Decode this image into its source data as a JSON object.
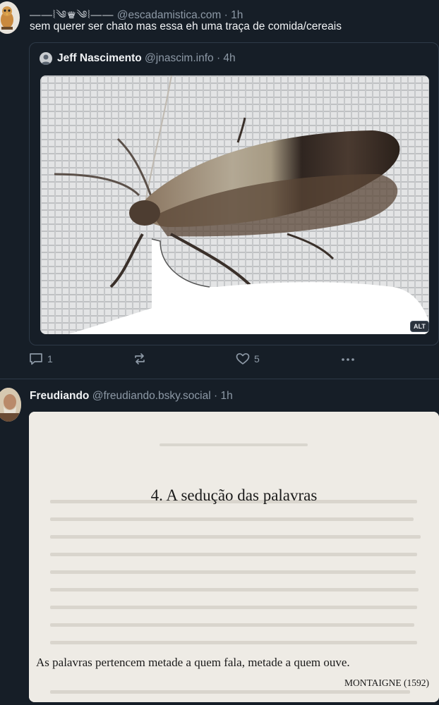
{
  "post1": {
    "handle": "@escadamistica.com",
    "ornament": "——⦚༄♛༄⦚——",
    "dot": "·",
    "time": "1h",
    "text": "sem querer ser chato mas essa eh uma traça de comida/cereais",
    "quote": {
      "name": "Jeff Nascimento",
      "handle": "@jnascim.info",
      "dot": "·",
      "time": "4h",
      "alt_label": "ALT"
    },
    "actions": {
      "reply_count": "1",
      "like_count": "5"
    }
  },
  "post2": {
    "name": "Freudiando",
    "handle": "@freudiando.bsky.social",
    "dot": "·",
    "time": "1h",
    "book": {
      "chapter_title": "4. A sedução das palavras",
      "quote": "As palavras pertencem metade a quem fala, metade a quem ouve.",
      "attribution": "MONTAIGNE (1592)"
    }
  },
  "colors": {
    "background": "#161e27",
    "muted": "#8d99a6",
    "divider": "#2e3a48"
  }
}
